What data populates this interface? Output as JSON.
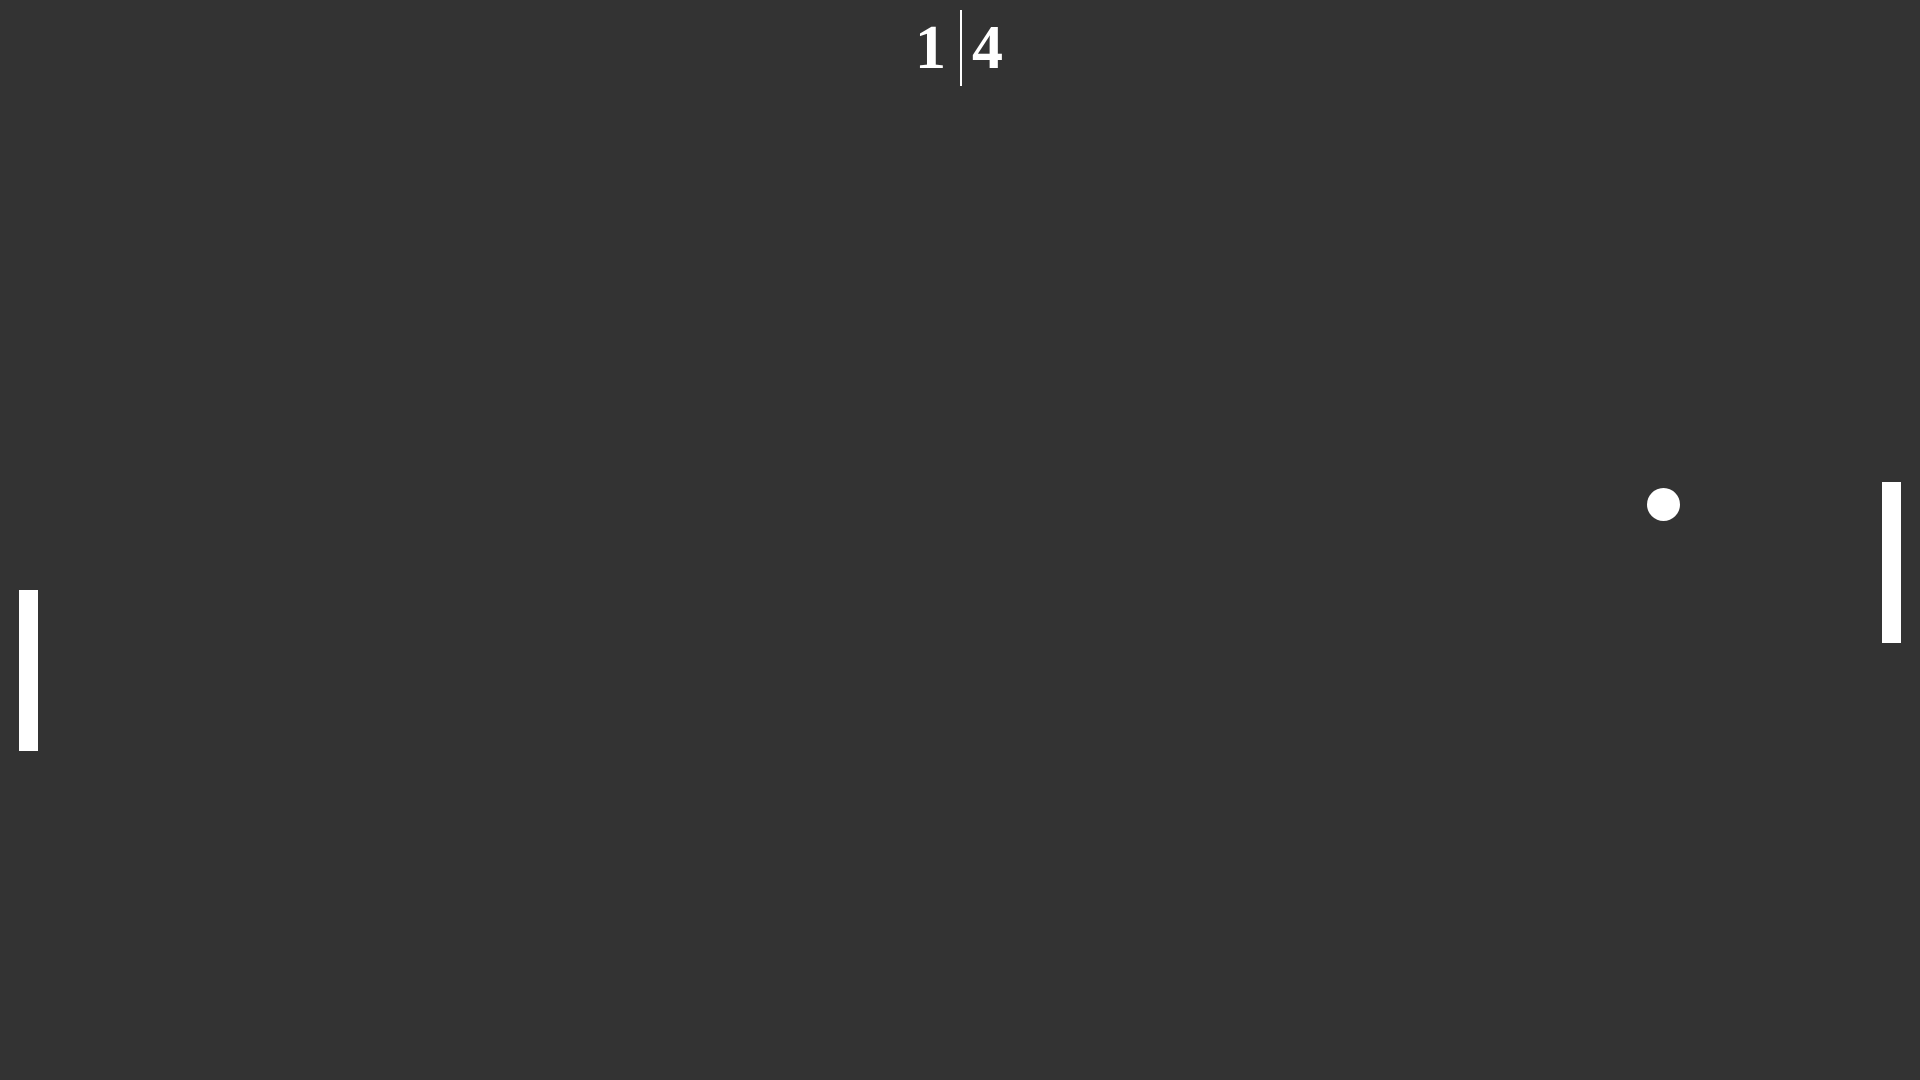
{
  "scoreboard": {
    "left_score": "1",
    "right_score": "4"
  },
  "colors": {
    "background": "#333333",
    "foreground": "#ffffff"
  },
  "icons": {
    "ball": "circle-ball-icon"
  }
}
